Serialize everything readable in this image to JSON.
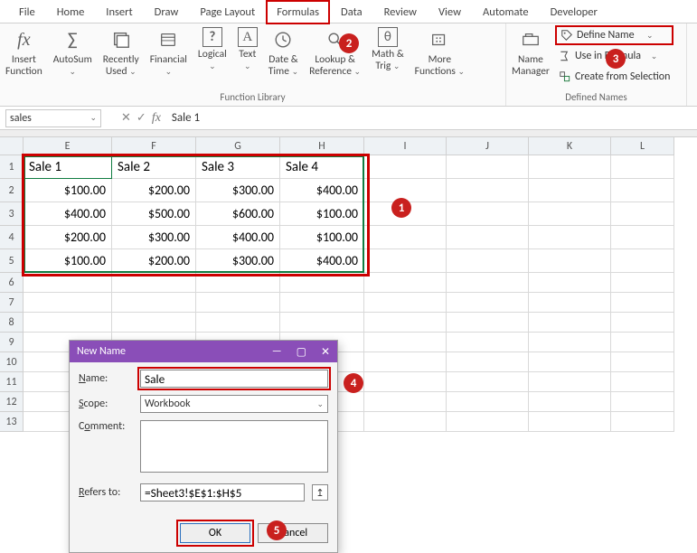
{
  "tabs": [
    "File",
    "Home",
    "Insert",
    "Draw",
    "Page Layout",
    "Formulas",
    "Data",
    "Review",
    "View",
    "Automate",
    "Developer"
  ],
  "active_tab": "Formulas",
  "ribbon": {
    "insert_function": "Insert\nFunction",
    "autosum": "AutoSum",
    "recently": "Recently\nUsed",
    "financial": "Financial",
    "logical": "Logical",
    "text": "Text",
    "date_time": "Date &\nTime",
    "lookup_ref": "Lookup &\nReference",
    "math_trig": "Math &\nTrig",
    "more_fn": "More\nFunctions",
    "group_fnlib": "Function Library",
    "name_manager": "Name\nManager",
    "define_name": "Define Name",
    "use_in_formula": "Use in Formula",
    "create_from_sel": "Create from Selection",
    "group_defnames": "Defined Names"
  },
  "namebox": "sales",
  "formula_bar": "Sale 1",
  "columns": [
    "E",
    "F",
    "G",
    "H",
    "I",
    "J",
    "K",
    "L"
  ],
  "row_numbers": [
    1,
    2,
    3,
    4,
    5,
    6,
    7,
    8,
    9,
    10,
    11,
    12,
    13
  ],
  "table": {
    "headers": [
      "Sale 1",
      "Sale 2",
      "Sale 3",
      "Sale 4"
    ],
    "rows": [
      [
        "$100.00",
        "$200.00",
        "$300.00",
        "$400.00"
      ],
      [
        "$400.00",
        "$500.00",
        "$600.00",
        "$100.00"
      ],
      [
        "$200.00",
        "$300.00",
        "$400.00",
        "$100.00"
      ],
      [
        "$100.00",
        "$200.00",
        "$300.00",
        "$400.00"
      ]
    ]
  },
  "dialog": {
    "title": "New Name",
    "name_label": "Name:",
    "name_value": "Sale",
    "scope_label": "Scope:",
    "scope_value": "Workbook",
    "comment_label": "Comment:",
    "comment_value": "",
    "refers_label": "Refers to:",
    "refers_value": "=Sheet3!$E$1:$H$5",
    "ok": "OK",
    "cancel": "Cancel"
  },
  "badges": {
    "b1": "1",
    "b2": "2",
    "b3": "3",
    "b4": "4",
    "b5": "5"
  }
}
